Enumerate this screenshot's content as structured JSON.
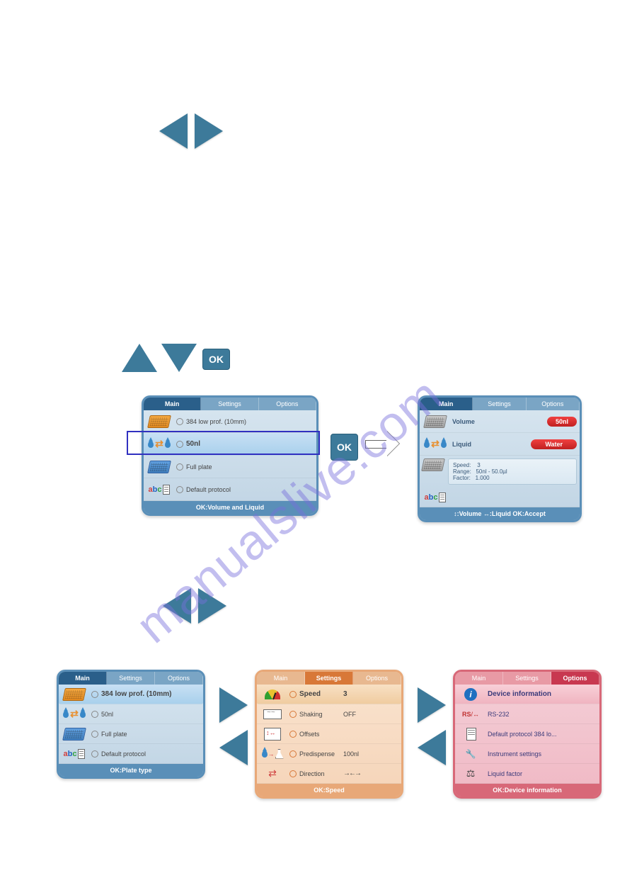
{
  "watermark_host": "manualslive.com",
  "controls": {
    "ok_label": "OK"
  },
  "tabs": {
    "main": "Main",
    "settings": "Settings",
    "options": "Options"
  },
  "panel_a": {
    "items": {
      "plate": "384 low prof. (10mm)",
      "liquid": "50nl",
      "full": "Full plate",
      "proto": "Default protocol"
    },
    "footer": "OK:Volume and Liquid"
  },
  "panel_b": {
    "volume_label": "Volume",
    "volume_value": "50nl",
    "liquid_label": "Liquid",
    "liquid_value": "Water",
    "info": {
      "speed_k": "Speed:",
      "speed_v": "3",
      "range_k": "Range:",
      "range_v": "50nl - 50.0µl",
      "factor_k": "Factor:",
      "factor_v": "1.000"
    },
    "footer": "↕:Volume  ↔:Liquid  OK:Accept"
  },
  "panel_main_small": {
    "items": {
      "plate": "384 low prof. (10mm)",
      "liquid": "50nl",
      "full": "Full plate",
      "proto": "Default protocol"
    },
    "footer": "OK:Plate type"
  },
  "panel_settings": {
    "speed_k": "Speed",
    "speed_v": "3",
    "shaking_k": "Shaking",
    "shaking_v": "OFF",
    "offsets_k": "Offsets",
    "predisp_k": "Predispense",
    "predisp_v": "100nl",
    "direction_k": "Direction",
    "direction_v": "→←→",
    "footer": "OK:Speed"
  },
  "panel_options": {
    "device_info": "Device information",
    "rs232": "RS-232",
    "rs_label": "RS",
    "def_proto": "Default protocol 384 lo...",
    "instr": "Instrument settings",
    "liqfac": "Liquid factor",
    "footer": "OK:Device information"
  }
}
